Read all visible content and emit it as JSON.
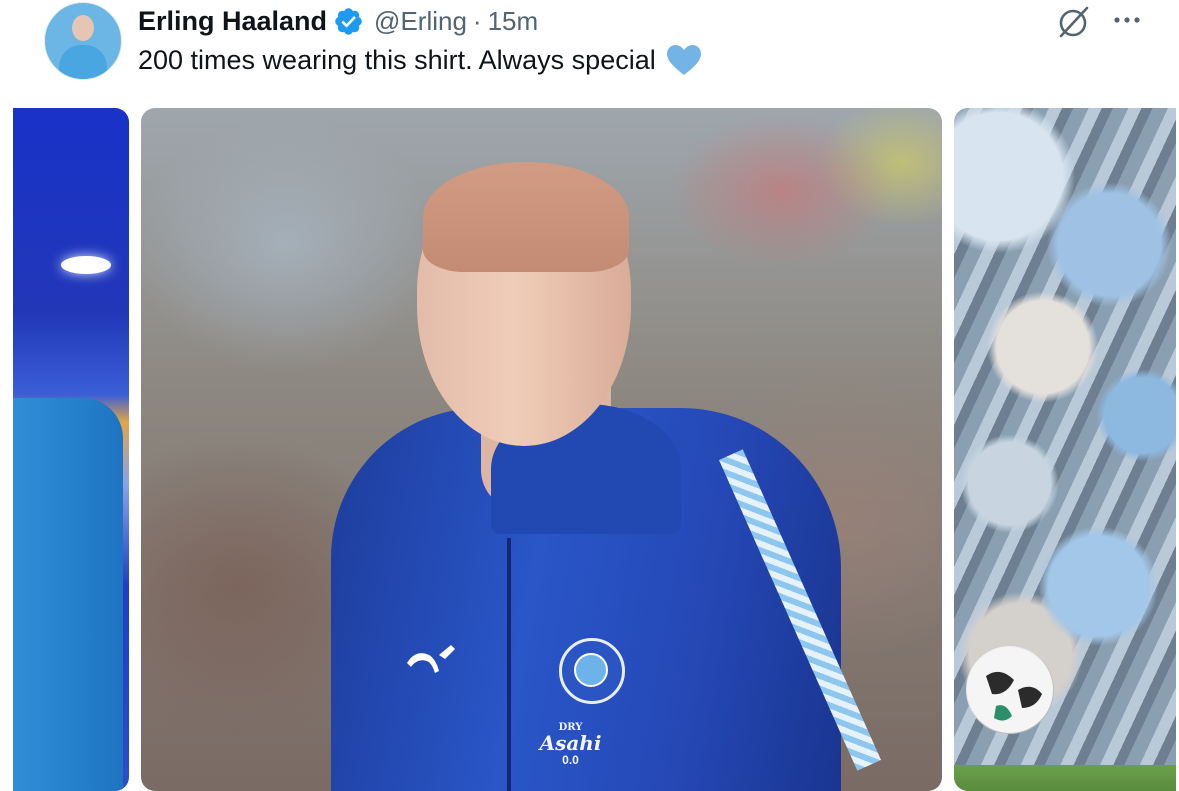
{
  "tweet": {
    "author_name": "Erling Haaland",
    "handle": "@Erling",
    "separator": "·",
    "time": "15m",
    "text": "200 times wearing this shirt. Always special",
    "emoji_name": "light-blue-heart",
    "verified": true
  },
  "icons": {
    "verified": "verified-badge-icon",
    "grok": "grok-icon",
    "more": "more-options-icon"
  },
  "media": {
    "count": 3
  },
  "colors": {
    "verified_blue": "#1d9bf0",
    "heart_blue": "#74b3e6",
    "secondary_text": "#536471"
  }
}
